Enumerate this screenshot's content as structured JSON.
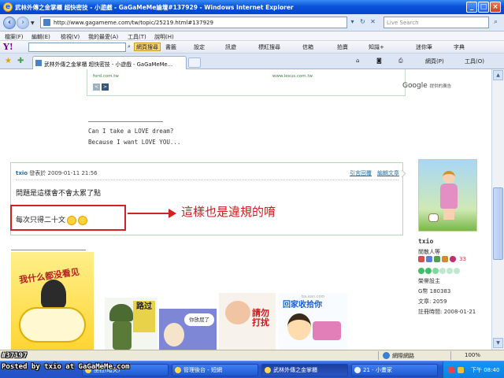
{
  "window": {
    "title": "武林外傳之金掌櫃 超快密技 - 小遊戲 - GaGaMeMe論壇#137929 - Windows Internet Explorer",
    "buttons": [
      "_",
      "□",
      "×"
    ]
  },
  "address_bar": {
    "url": "http://www.gagameme.com/tw/topic/25219.html#137929",
    "live_search_placeholder": "Live Search"
  },
  "menu": [
    "檔案(F)",
    "編輯(E)",
    "檢視(V)",
    "我的最愛(A)",
    "工具(T)",
    "說明(H)"
  ],
  "yahoo_toolbar": {
    "logo": "Y!",
    "search_button": "網頁搜尋",
    "items": [
      "書籤",
      "設定",
      "訊遊",
      "標紅搜尋",
      "信箱",
      "拍賣",
      "知識+",
      "迷你筆",
      "字典"
    ]
  },
  "tabs": {
    "active_tab": "武林外傳之金掌櫃 超快密技 - 小遊戲 - GaGaMeMe...",
    "tools": [
      "網頁(P)",
      "工具(O)"
    ]
  },
  "ad": {
    "url_left": "ford.com.tw",
    "url_right": "www.lexus.com.tw",
    "prev": "<",
    "next": ">",
    "google_label": "Google",
    "google_suffix": "提供的廣告"
  },
  "signature": {
    "line1": "Can I take a LOVE dream?",
    "line2": "Because I want LOVE YOU..."
  },
  "post": {
    "username": "txio",
    "posted_prefix": "發表於",
    "posted_at": "2009-01-11 21:56",
    "reply_link": "引言回覆",
    "edit_link": "編輯文章",
    "question": "問題是這樣會不會太累了點",
    "highlight_text": "每次只得二十文",
    "annotation": "這樣也是違規的唷"
  },
  "user_panel": {
    "name": "txio",
    "rank": "閒散人等",
    "reputation": "33",
    "title": "榮譽設主",
    "coins": "G幣 180383",
    "posts": "文章: 2059",
    "registered": "註冊時間: 2008-01-21"
  },
  "images": {
    "img1_caption": "我什么都没看见",
    "img2_caption": "路过",
    "img3_caption": "你放屁了",
    "img4_caption": "請勿打扰",
    "img5_caption": "回家收拾你",
    "img5_site": "ba.ean.com"
  },
  "status_bar": {
    "zone": "網際網路",
    "zoom": "100%"
  },
  "taskbar": {
    "tasks": [
      "巫拉(暗夫)",
      "管理後台 - 短網",
      "武林外傳之金掌櫃",
      "21 - 小畫家"
    ],
    "clock": "下午 08:40"
  },
  "watermark": {
    "top": "#37197",
    "bottom": "Posted by txio at GaGaMeMe.com"
  },
  "colors": {
    "highlight_red": "#d42020",
    "link_blue": "#2a6e9e",
    "ie_blue": "#0a52d8"
  }
}
